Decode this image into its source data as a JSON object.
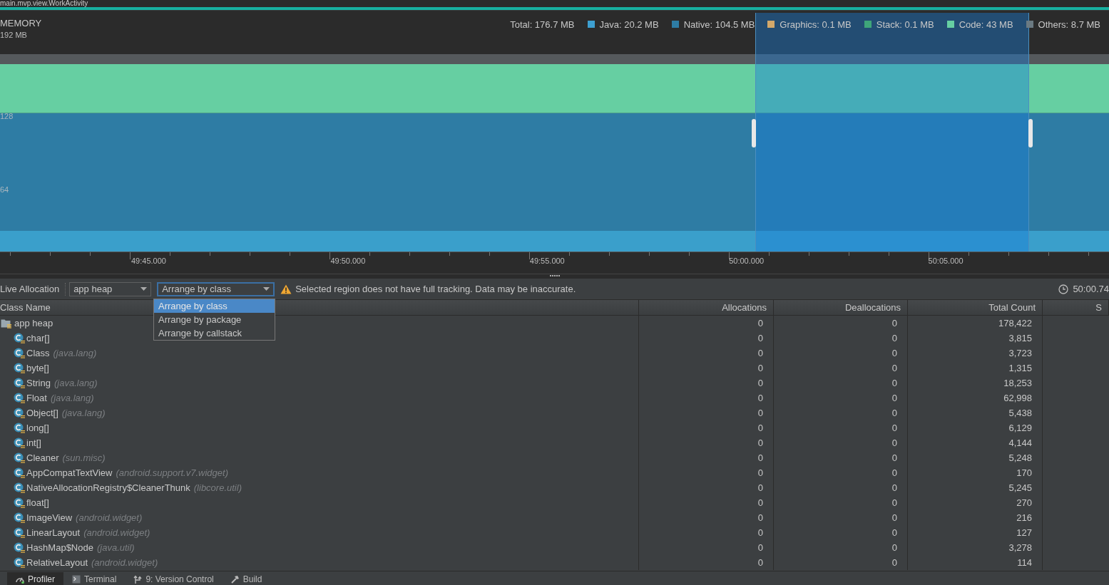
{
  "window": {
    "title": "main.mvp.view.WorkActivity"
  },
  "memory": {
    "title": "MEMORY",
    "max_label": "192 MB",
    "legend": [
      {
        "label": "Total: 176.7 MB"
      },
      {
        "label": "Java: 20.2 MB",
        "color": "#3d9fd0"
      },
      {
        "label": "Native: 104.5 MB",
        "color": "#2e7ca4"
      },
      {
        "label": "Graphics: 0.1 MB",
        "color": "#d3a86a"
      },
      {
        "label": "Stack: 0.1 MB",
        "color": "#3fa57a"
      },
      {
        "label": "Code: 43 MB",
        "color": "#66cfa2"
      },
      {
        "label": "Others: 8.7 MB",
        "color": "#6b7a82"
      }
    ],
    "axis_labels": [
      "128",
      "64"
    ],
    "time_labels": [
      "49:45.000",
      "49:50.000",
      "49:55.000",
      "50:00.000",
      "50:05.000"
    ]
  },
  "toolbar": {
    "label": "Live Allocation",
    "heap_select": {
      "value": "app heap"
    },
    "arrange_select": {
      "value": "Arrange by class",
      "expanded": true,
      "options": [
        {
          "label": "Arrange by class",
          "selected": true
        },
        {
          "label": "Arrange by package",
          "selected": false
        },
        {
          "label": "Arrange by callstack",
          "selected": false
        }
      ]
    },
    "warning": "Selected region does not have full tracking. Data may be inaccurate.",
    "time": "50:00.74"
  },
  "table": {
    "columns": [
      "Class Name",
      "Allocations",
      "Deallocations",
      "Total Count",
      "S"
    ],
    "rows": [
      {
        "kind": "heap",
        "name": "app heap",
        "allocations": "0",
        "deallocations": "0",
        "total_count": "178,422",
        "children": [
          {
            "kind": "class",
            "name": "char[]",
            "allocations": "0",
            "deallocations": "0",
            "total_count": "3,815"
          },
          {
            "kind": "class",
            "name": "Class",
            "package": "(java.lang)",
            "allocations": "0",
            "deallocations": "0",
            "total_count": "3,723"
          },
          {
            "kind": "class",
            "name": "byte[]",
            "allocations": "0",
            "deallocations": "0",
            "total_count": "1,315"
          },
          {
            "kind": "class",
            "name": "String",
            "package": "(java.lang)",
            "allocations": "0",
            "deallocations": "0",
            "total_count": "18,253"
          },
          {
            "kind": "class",
            "name": "Float",
            "package": "(java.lang)",
            "allocations": "0",
            "deallocations": "0",
            "total_count": "62,998"
          },
          {
            "kind": "class",
            "name": "Object[]",
            "package": "(java.lang)",
            "allocations": "0",
            "deallocations": "0",
            "total_count": "5,438"
          },
          {
            "kind": "class",
            "name": "long[]",
            "allocations": "0",
            "deallocations": "0",
            "total_count": "6,129"
          },
          {
            "kind": "class",
            "name": "int[]",
            "allocations": "0",
            "deallocations": "0",
            "total_count": "4,144"
          },
          {
            "kind": "class",
            "name": "Cleaner",
            "package": "(sun.misc)",
            "allocations": "0",
            "deallocations": "0",
            "total_count": "5,248"
          },
          {
            "kind": "class",
            "name": "AppCompatTextView",
            "package": "(android.support.v7.widget)",
            "allocations": "0",
            "deallocations": "0",
            "total_count": "170"
          },
          {
            "kind": "class",
            "name": "NativeAllocationRegistry$CleanerThunk",
            "package": "(libcore.util)",
            "allocations": "0",
            "deallocations": "0",
            "total_count": "5,245"
          },
          {
            "kind": "class",
            "name": "float[]",
            "allocations": "0",
            "deallocations": "0",
            "total_count": "270"
          },
          {
            "kind": "class",
            "name": "ImageView",
            "package": "(android.widget)",
            "allocations": "0",
            "deallocations": "0",
            "total_count": "216"
          },
          {
            "kind": "class",
            "name": "LinearLayout",
            "package": "(android.widget)",
            "allocations": "0",
            "deallocations": "0",
            "total_count": "127"
          },
          {
            "kind": "class",
            "name": "HashMap$Node",
            "package": "(java.util)",
            "allocations": "0",
            "deallocations": "0",
            "total_count": "3,278"
          },
          {
            "kind": "class",
            "name": "RelativeLayout",
            "package": "(android.widget)",
            "allocations": "0",
            "deallocations": "0",
            "total_count": "114"
          }
        ]
      }
    ]
  },
  "bottom_tabs": [
    {
      "kind": "profiler",
      "label": "Profiler",
      "selected": true
    },
    {
      "kind": "terminal",
      "label": "Terminal",
      "selected": false
    },
    {
      "kind": "vcs",
      "label": "9: Version Control",
      "selected": false
    },
    {
      "kind": "build",
      "label": "Build",
      "selected": false
    }
  ]
}
